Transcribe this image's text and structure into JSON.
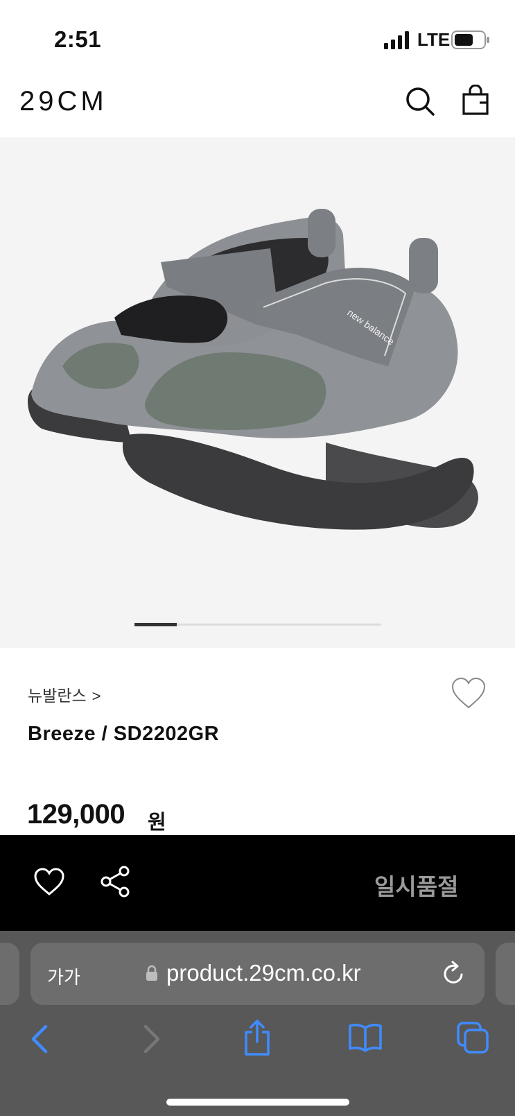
{
  "status_bar": {
    "time": "2:51",
    "network": "LTE",
    "icons": [
      "signal-icon",
      "battery-icon"
    ]
  },
  "header": {
    "logo": "29CM",
    "icons": [
      "search-icon",
      "shopping-bag-icon"
    ]
  },
  "product": {
    "image_description_icon": "shoe-image",
    "carousel": {
      "current_index": 1,
      "progress_fraction": 0.17
    },
    "brand": "뉴발란스",
    "brand_chevron": ">",
    "name": "Breeze / SD2202GR",
    "price": "129,000",
    "price_unit": "원",
    "shoe_print": "new balance"
  },
  "action_bar": {
    "icons": [
      "heart-icon",
      "share-icon"
    ],
    "status_label": "일시품절"
  },
  "browser": {
    "text_size_label": "가가",
    "url": "product.29cm.co.kr",
    "icons": [
      "lock-icon",
      "reload-icon",
      "back-icon",
      "forward-icon",
      "share-icon",
      "bookmarks-icon",
      "tabs-icon"
    ]
  },
  "colors": {
    "action_bar_bg": "#000000",
    "browser_bg": "#585858",
    "accent_blue": "#3f8cff",
    "soldout_text": "#9a9a9a"
  }
}
